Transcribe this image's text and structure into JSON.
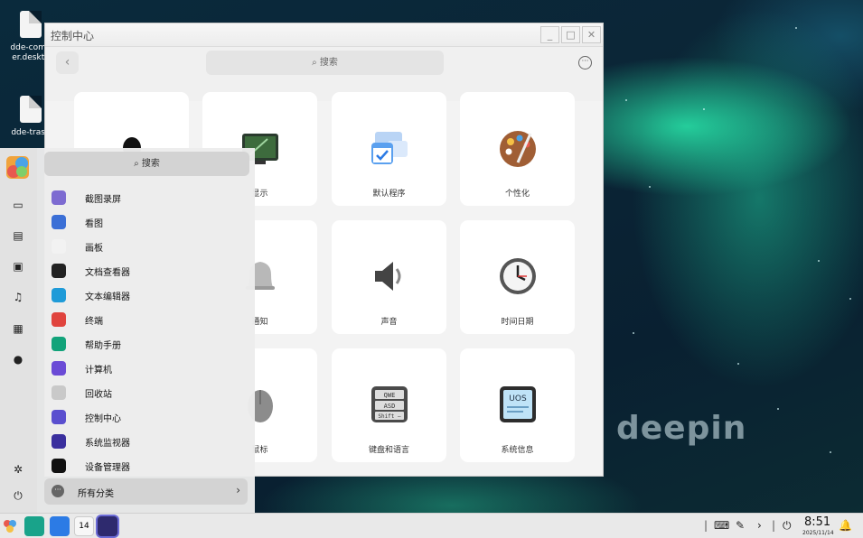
{
  "desktop": {
    "icons": [
      {
        "label": "dde-computer.desktop",
        "line1": "dde-comp",
        "line2": "er.deskto"
      },
      {
        "label": "dde-trash",
        "line1": "dde-trash",
        "line2": ""
      }
    ],
    "watermark": "deepin"
  },
  "control_center": {
    "title": "控制中心",
    "buttons": {
      "minimize": "_",
      "maximize": "□",
      "close": "✕",
      "back": "‹",
      "more": "···"
    },
    "search_placeholder": "搜索",
    "cards": [
      {
        "label": "",
        "icon": "account-icon"
      },
      {
        "label": "显示",
        "icon": "display-icon"
      },
      {
        "label": "默认程序",
        "icon": "default-apps-icon"
      },
      {
        "label": "个性化",
        "icon": "personalization-icon"
      },
      {
        "label": "通知",
        "icon": "notification-bell-icon"
      },
      {
        "label": "声音",
        "icon": "speaker-icon"
      },
      {
        "label": "时间日期",
        "icon": "clock-icon"
      },
      {
        "label": "鼠标",
        "icon": "mouse-icon"
      },
      {
        "label": "键盘和语言",
        "icon": "keyboard-icon"
      },
      {
        "label": "系统信息",
        "icon": "system-info-icon"
      }
    ],
    "system_info_badge": "UOS",
    "keyboard_keys": [
      "QWE",
      "ASD",
      "Shift —"
    ]
  },
  "launcher": {
    "search_placeholder": "搜索",
    "apps": [
      {
        "label": "截图录屏",
        "icon": "screenshot-icon",
        "color": "#7d6bd1"
      },
      {
        "label": "看图",
        "icon": "image-viewer-icon",
        "color": "#3b6fd6"
      },
      {
        "label": "画板",
        "icon": "draw-icon",
        "color": "#f2f2f2"
      },
      {
        "label": "文档查看器",
        "icon": "document-viewer-icon",
        "color": "#222222"
      },
      {
        "label": "文本编辑器",
        "icon": "text-editor-icon",
        "color": "#1f9bd8"
      },
      {
        "label": "终端",
        "icon": "terminal-icon",
        "color": "#e0443e"
      },
      {
        "label": "帮助手册",
        "icon": "manual-icon",
        "color": "#12a37a"
      },
      {
        "label": "计算机",
        "icon": "computer-icon",
        "color": "#6b4bd6"
      },
      {
        "label": "回收站",
        "icon": "trash-icon",
        "color": "#c9c9c9"
      },
      {
        "label": "控制中心",
        "icon": "control-center-icon",
        "color": "#5a4fcf"
      },
      {
        "label": "系统监视器",
        "icon": "system-monitor-icon",
        "color": "#3a2f9e"
      },
      {
        "label": "设备管理器",
        "icon": "device-manager-icon",
        "color": "#111111"
      }
    ],
    "all_categories": "所有分类",
    "sidebar": [
      "logo-icon",
      "monitor-icon",
      "document-icon",
      "picture-icon",
      "music-icon",
      "video-icon",
      "download-icon",
      "settings-icon",
      "power-icon"
    ]
  },
  "taskbar": {
    "time": "8:51",
    "date": "2025/11/14",
    "apps": [
      "launcher-icon",
      "file-manager-icon",
      "app-store-icon",
      "calendar-icon",
      "control-center-icon"
    ],
    "calendar_day": "14"
  }
}
